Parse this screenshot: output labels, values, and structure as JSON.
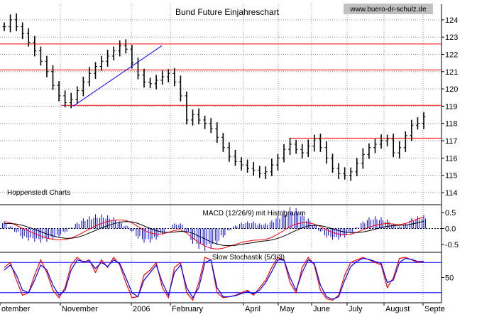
{
  "chart_data": [
    {
      "type": "candlestick",
      "title": "Bund Future Einjahreschart",
      "watermark": "www.buero-dr-schulz.de",
      "source_label": "Hoppenstedt Charts",
      "x_ticks": [
        "otember",
        "November",
        "2006",
        "February",
        "April",
        "May",
        "June",
        "July",
        "August",
        "Septe"
      ],
      "y_ticks": [
        114,
        115,
        116,
        117,
        118,
        119,
        120,
        121,
        122,
        123,
        124
      ],
      "ylim": [
        113.3,
        124.9
      ],
      "resistance_lines": [
        122.6,
        121.1,
        119.05
      ],
      "short_resistance_line": 117.15,
      "trendline": {
        "from": 119.0,
        "to": 122.5
      },
      "series": [
        {
          "values": [
            123.6,
            124.0,
            123.6,
            123.2,
            122.7,
            122.2,
            121.6,
            121.0,
            120.2,
            119.6,
            119.2,
            119.4,
            119.9,
            120.4,
            120.9,
            121.3,
            121.6,
            121.9,
            122.2,
            122.5,
            122.3,
            121.5,
            120.8,
            120.4,
            120.3,
            120.5,
            120.7,
            120.9,
            120.4,
            119.6,
            118.2,
            118.5,
            118.2,
            118.0,
            117.7,
            117.2,
            116.6,
            116.1,
            115.8,
            115.6,
            115.4,
            115.3,
            115.1,
            115.2,
            115.6,
            116.0,
            116.5,
            116.8,
            116.5,
            116.3,
            116.7,
            117.1,
            116.6,
            116.0,
            115.4,
            115.1,
            115.0,
            115.2,
            115.7,
            116.2,
            116.6,
            116.8,
            117.0,
            117.1,
            116.3,
            116.6,
            117.3,
            117.9,
            118.0,
            118.4
          ],
          "color": "#000000"
        }
      ],
      "color": "#000000",
      "line_color": "#ff0000",
      "trend_color": "#0000ff"
    },
    {
      "type": "line",
      "title": "MACD (12/26/9) mit Histogramm",
      "y_ticks": [
        0.5,
        0.0,
        -0.5
      ],
      "ylim": [
        -0.75,
        0.75
      ],
      "series": [
        {
          "values": [
            0.22,
            0.18,
            0.1,
            0.0,
            -0.08,
            -0.16,
            -0.24,
            -0.3,
            -0.34,
            -0.36,
            -0.35,
            -0.3,
            -0.22,
            -0.12,
            -0.02,
            0.08,
            0.16,
            0.22,
            0.26,
            0.27,
            0.25,
            0.18,
            0.06,
            -0.06,
            -0.14,
            -0.18,
            -0.17,
            -0.12,
            -0.06,
            -0.04,
            -0.14,
            -0.3,
            -0.44,
            -0.55,
            -0.62,
            -0.65,
            -0.62,
            -0.56,
            -0.5,
            -0.44,
            -0.4,
            -0.37,
            -0.36,
            -0.34,
            -0.28,
            -0.18,
            -0.06,
            0.06,
            0.14,
            0.18,
            0.18,
            0.14,
            0.06,
            -0.04,
            -0.12,
            -0.18,
            -0.2,
            -0.18,
            -0.12,
            -0.04,
            0.04,
            0.1,
            0.14,
            0.16,
            0.14,
            0.12,
            0.16,
            0.24,
            0.3,
            0.36
          ],
          "color": "#ff0000"
        },
        {
          "values": [
            0.15,
            0.16,
            0.14,
            0.1,
            0.04,
            -0.03,
            -0.1,
            -0.17,
            -0.23,
            -0.28,
            -0.31,
            -0.31,
            -0.28,
            -0.22,
            -0.14,
            -0.06,
            0.02,
            0.09,
            0.15,
            0.2,
            0.22,
            0.21,
            0.16,
            0.08,
            0.0,
            -0.07,
            -0.11,
            -0.12,
            -0.11,
            -0.09,
            -0.1,
            -0.15,
            -0.24,
            -0.33,
            -0.42,
            -0.49,
            -0.53,
            -0.54,
            -0.53,
            -0.5,
            -0.47,
            -0.44,
            -0.41,
            -0.39,
            -0.36,
            -0.31,
            -0.24,
            -0.15,
            -0.06,
            0.02,
            0.08,
            0.1,
            0.09,
            0.05,
            -0.01,
            -0.07,
            -0.11,
            -0.13,
            -0.13,
            -0.11,
            -0.07,
            -0.02,
            0.03,
            0.07,
            0.09,
            0.1,
            0.11,
            0.14,
            0.18,
            0.23
          ],
          "color": "#000000"
        }
      ],
      "histogram_color": "#0000ff",
      "zero_line_color": "#000000"
    },
    {
      "type": "line",
      "title": "Slow Stochastik (5/3/3)",
      "y_ticks": [
        50
      ],
      "ylim": [
        0,
        100
      ],
      "reference_lines": [
        80,
        20
      ],
      "series": [
        {
          "values": [
            70,
            80,
            45,
            15,
            20,
            55,
            85,
            60,
            25,
            10,
            30,
            75,
            90,
            80,
            85,
            60,
            85,
            70,
            90,
            75,
            40,
            10,
            12,
            55,
            65,
            80,
            30,
            10,
            70,
            80,
            20,
            5,
            40,
            90,
            85,
            20,
            10,
            12,
            15,
            20,
            25,
            15,
            30,
            45,
            70,
            90,
            85,
            40,
            20,
            70,
            90,
            75,
            25,
            8,
            5,
            15,
            55,
            80,
            85,
            90,
            85,
            80,
            75,
            30,
            50,
            88,
            90,
            85,
            80,
            82
          ],
          "color": "#ff0000"
        },
        {
          "values": [
            65,
            75,
            55,
            25,
            20,
            45,
            75,
            65,
            35,
            15,
            25,
            65,
            85,
            82,
            83,
            68,
            80,
            72,
            85,
            78,
            50,
            20,
            12,
            45,
            60,
            75,
            40,
            15,
            60,
            75,
            30,
            10,
            30,
            80,
            85,
            30,
            12,
            12,
            14,
            18,
            22,
            18,
            25,
            40,
            62,
            85,
            85,
            50,
            25,
            60,
            85,
            78,
            35,
            12,
            7,
            12,
            45,
            72,
            82,
            88,
            86,
            82,
            78,
            40,
            45,
            80,
            88,
            86,
            82,
            82
          ],
          "color": "#0000ff"
        }
      ]
    }
  ]
}
